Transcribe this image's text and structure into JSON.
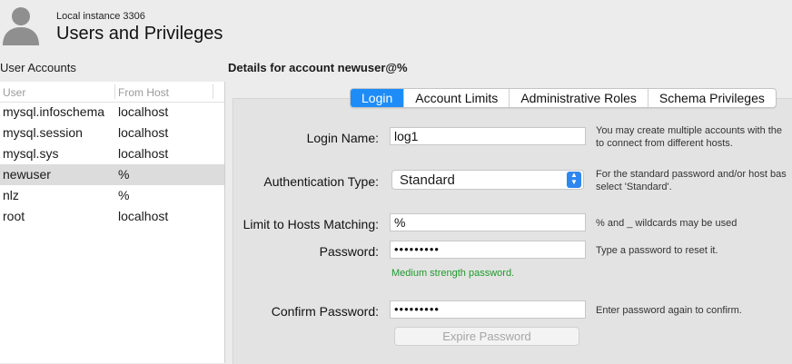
{
  "header": {
    "instance": "Local instance 3306",
    "title": "Users and Privileges",
    "avatar_icon": "user-silhouette-icon"
  },
  "accounts": {
    "label": "User Accounts",
    "columns": [
      "User",
      "From Host"
    ],
    "rows": [
      {
        "user": "mysql.infoschema",
        "host": "localhost"
      },
      {
        "user": "mysql.session",
        "host": "localhost"
      },
      {
        "user": "mysql.sys",
        "host": "localhost"
      },
      {
        "user": "newuser",
        "host": "%"
      },
      {
        "user": "nlz",
        "host": "%"
      },
      {
        "user": "root",
        "host": "localhost"
      }
    ],
    "selected_index": 3
  },
  "details": {
    "title": "Details for account newuser@%",
    "tabs": [
      "Login",
      "Account Limits",
      "Administrative Roles",
      "Schema Privileges"
    ],
    "active_tab": "Login",
    "login_name": {
      "label": "Login Name:",
      "value": "log1",
      "help_line1": "You may create multiple accounts with the",
      "help_line2": "to connect from different hosts."
    },
    "auth_type": {
      "label": "Authentication Type:",
      "value": "Standard",
      "help_line1": "For the standard password and/or host bas",
      "help_line2": "select 'Standard'."
    },
    "hosts": {
      "label": "Limit to Hosts Matching:",
      "value": "%",
      "help": "% and _ wildcards may be used"
    },
    "password": {
      "label": "Password:",
      "value": "•••••••••",
      "help": "Type a password to reset it.",
      "strength": "Medium strength password."
    },
    "confirm": {
      "label": "Confirm Password:",
      "value": "•••••••••",
      "help": "Enter password again to confirm."
    },
    "expire_button": "Expire Password"
  },
  "colors": {
    "accent": "#1e8cf6",
    "strength_text": "#1e9a2a",
    "selected_row": "#dcdcdc"
  }
}
